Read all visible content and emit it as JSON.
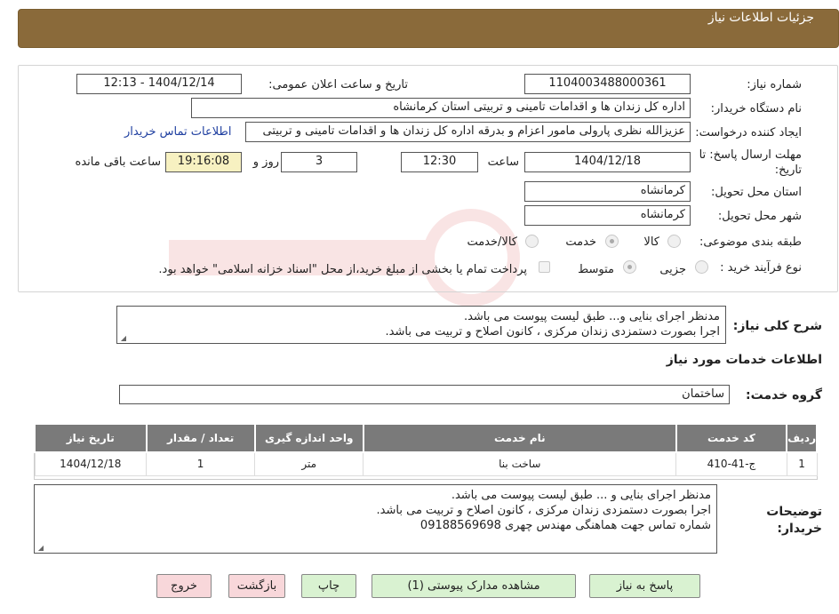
{
  "header": {
    "title": "جزئیات اطلاعات نیاز"
  },
  "form": {
    "need_number": {
      "label": "شماره نیاز:",
      "value": "1104003488000361"
    },
    "announce_datetime": {
      "label": "تاریخ و ساعت اعلان عمومی:",
      "value": "1404/12/14 - 12:13"
    },
    "buyer_org": {
      "label": "نام دستگاه خریدار:",
      "value": "اداره کل زندان ها و اقدامات تامینی و تربیتی استان کرمانشاه"
    },
    "requester": {
      "label": "ایجاد کننده درخواست:",
      "value": "عزیزالله نظری پارولی مامور اعزام و بدرقه اداره کل زندان ها و اقدامات تامینی و تربیتی",
      "contact_link": "اطلاعات تماس خریدار"
    },
    "deadline": {
      "label_line1": "مهلت ارسال پاسخ: تا",
      "label_line2": "تاریخ:",
      "date": "1404/12/18",
      "time_label": "ساعت",
      "time": "12:30",
      "days": "3",
      "days_label": "روز و",
      "remaining": "19:16:08",
      "remaining_label": "ساعت باقی مانده"
    },
    "province": {
      "label": "استان محل تحویل:",
      "value": "کرمانشاه"
    },
    "city": {
      "label": "شهر محل تحویل:",
      "value": "کرمانشاه"
    },
    "category": {
      "label": "طبقه بندی موضوعی:",
      "options": [
        "کالا",
        "خدمت",
        "کالا/خدمت"
      ],
      "selected": "خدمت"
    },
    "process": {
      "label": "نوع فرآیند خرید :",
      "options": [
        "جزیی",
        "متوسط"
      ],
      "selected": "متوسط",
      "treasury_note": "پرداخت تمام یا بخشی از مبلغ خرید،از محل \"اسناد خزانه اسلامی\" خواهد بود."
    }
  },
  "general_description": {
    "label": "شرح کلی نیاز:",
    "lines": [
      "مدنظر اجرای بنایی و... طبق لیست پیوست می باشد.",
      "اجرا بصورت دستمزدی زندان مرکزی ، کانون اصلاح و تربیت می باشد."
    ]
  },
  "services_section": {
    "title": "اطلاعات خدمات مورد نیاز",
    "group_label": "گروه خدمت:",
    "group_value": "ساختمان",
    "columns": [
      "ردیف",
      "کد خدمت",
      "نام خدمت",
      "واحد اندازه گیری",
      "تعداد / مقدار",
      "تاریخ نیاز"
    ],
    "rows": [
      {
        "row": "1",
        "code": "ج-41-410",
        "name": "ساخت بنا",
        "unit": "متر",
        "qty": "1",
        "date": "1404/12/18"
      }
    ]
  },
  "buyer_notes": {
    "label_line1": "توضیحات",
    "label_line2": "خریدار:",
    "lines": [
      "مدنظر اجرای بنایی و ... طبق لیست پیوست می باشد.",
      "اجرا بصورت دستمزدی زندان مرکزی ، کانون اصلاح و تربیت می باشد.",
      "شماره تماس جهت هماهنگی مهندس چهری 09188569698"
    ]
  },
  "buttons": {
    "reply": "پاسخ به نیاز",
    "attachments": "مشاهده مدارک پیوستی (1)",
    "print": "چاپ",
    "back": "بازگشت",
    "exit": "خروج"
  },
  "colors": {
    "header_bg": "#8a6a3a",
    "yellow_field": "#f7f1c1",
    "table_header": "#7a7a7a",
    "link": "#1f3fa0"
  }
}
